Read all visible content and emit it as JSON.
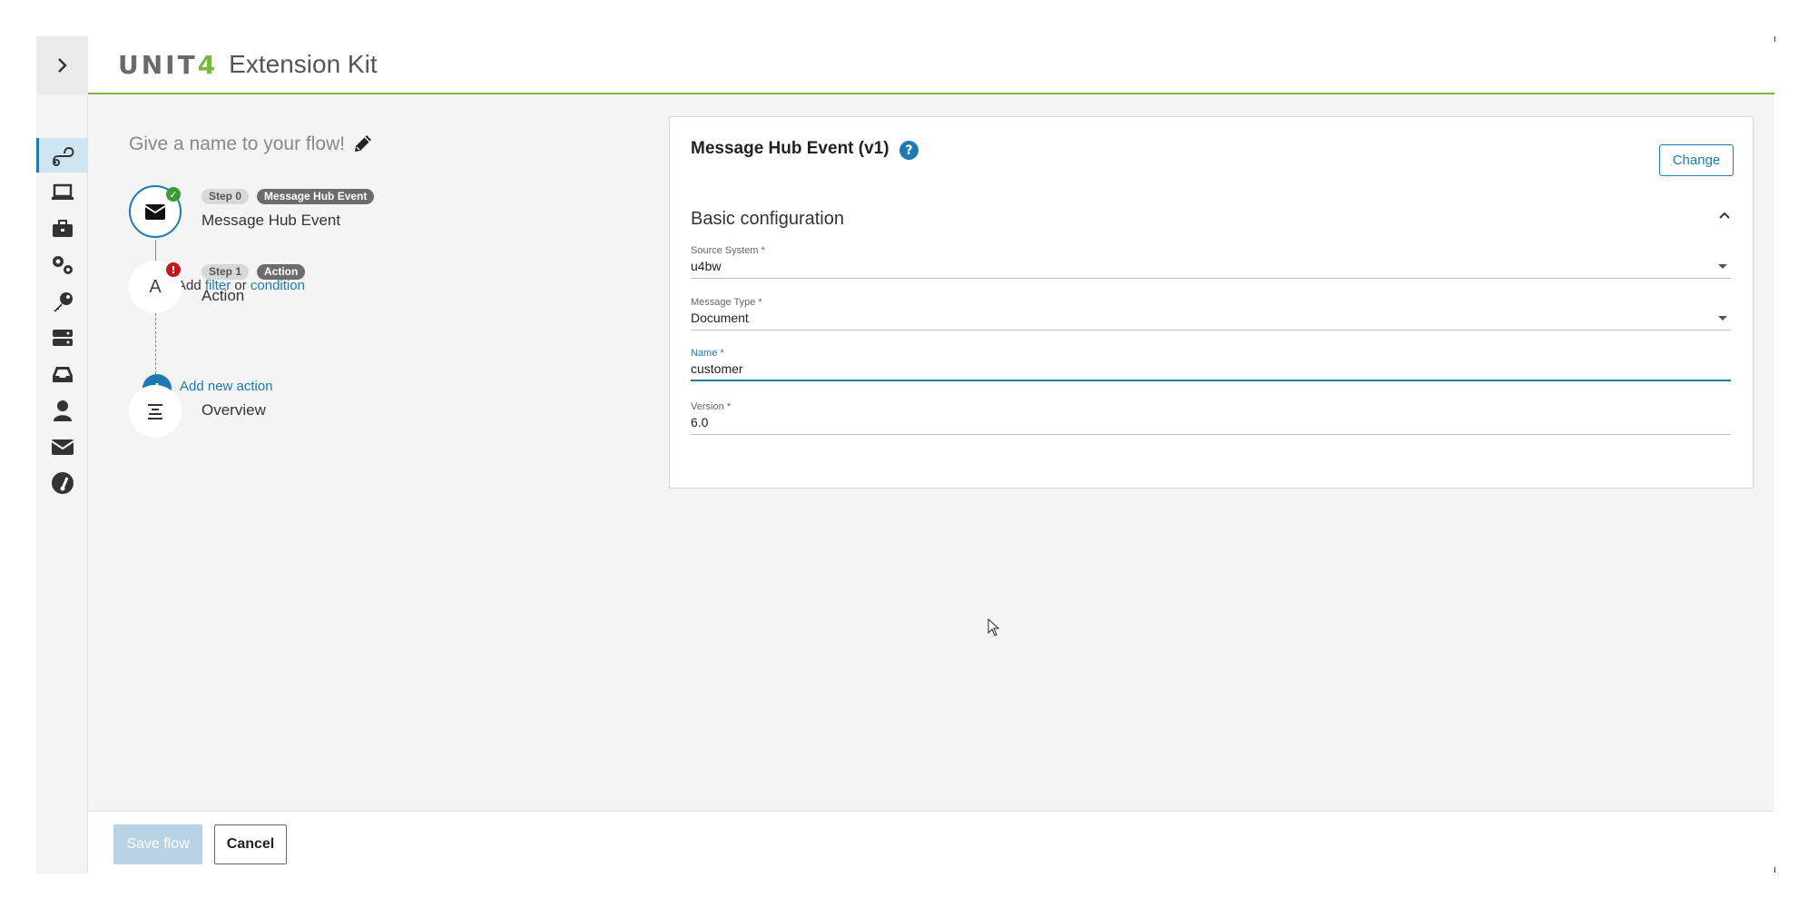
{
  "header": {
    "logo_main": "UNIT",
    "logo_accent": "4",
    "title": "Extension Kit"
  },
  "flow": {
    "name_placeholder": "Give a name to your flow!",
    "steps": [
      {
        "step_label": "Step 0",
        "type_label": "Message Hub Event",
        "title": "Message Hub Event",
        "status": "ok"
      },
      {
        "step_label": "Step 1",
        "type_label": "Action",
        "title": "Action",
        "status": "error",
        "icon_letter": "A"
      }
    ],
    "add": {
      "prefix": "Add",
      "filter": "filter",
      "or": "or",
      "condition": "condition"
    },
    "add_action_label": "Add new action",
    "overview_label": "Overview"
  },
  "panel": {
    "title": "Message Hub Event (v1)",
    "help": "?",
    "change_label": "Change",
    "section_title": "Basic configuration",
    "fields": {
      "source_system": {
        "label": "Source System *",
        "value": "u4bw"
      },
      "message_type": {
        "label": "Message Type *",
        "value": "Document"
      },
      "name": {
        "label": "Name *",
        "value": "customer"
      },
      "version": {
        "label": "Version *",
        "value": "6.0"
      }
    }
  },
  "footer": {
    "save_label": "Save flow",
    "cancel_label": "Cancel"
  },
  "colors": {
    "accent": "#1d7ab1",
    "brand_green": "#78b83c",
    "error": "#c4161c",
    "success": "#3a9b35"
  }
}
